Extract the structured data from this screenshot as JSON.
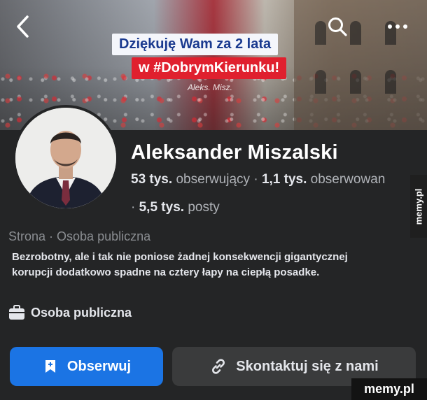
{
  "cover": {
    "banner_line1": "Dziękuję Wam za 2 lata",
    "banner_line2": "w #DobrymKierunku!",
    "signature": "Aleks. Misz."
  },
  "topbar": {
    "back_icon": "chevron-left-icon",
    "search_icon": "search-icon",
    "more_icon": "more-dots-icon"
  },
  "profile": {
    "name": "Aleksander Miszalski",
    "followers_count": "53 tys.",
    "followers_label": "obserwujący",
    "following_count": "1,1 tys.",
    "following_label": "obserwowan",
    "posts_count": "5,5 tys.",
    "posts_label": "posty",
    "category": "Strona · Osoba publiczna",
    "bio": "Bezrobotny, ale i tak nie poniose żadnej konsekwencji gigantycznej korupcji dodatkowo spadne na cztery łapy na ciepłą posadke.",
    "public_figure_label": "Osoba publiczna"
  },
  "actions": {
    "follow_label": "Obserwuj",
    "contact_label": "Skontaktuj się z nami"
  },
  "watermarks": {
    "side": "memy.pl",
    "bottom": "memy.pl"
  },
  "colors": {
    "background": "#242526",
    "primary_button": "#1b74e4",
    "secondary_button": "#3a3b3c",
    "banner_blue_text": "#1a3a8f",
    "banner_red": "#e0202e"
  }
}
